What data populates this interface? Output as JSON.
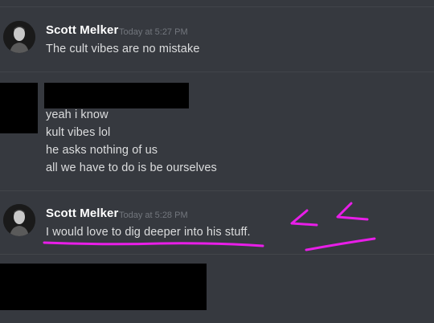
{
  "messages": [
    {
      "author": "Scott Melker",
      "timestamp": "Today at 5:27 PM",
      "lines": [
        "The cult vibes are no mistake"
      ]
    },
    {
      "author": "",
      "timestamp": "",
      "lines": [
        "yeah i know",
        "kult vibes lol",
        "he asks nothing of us",
        "all we have to do is be ourselves"
      ]
    },
    {
      "author": "Scott Melker",
      "timestamp": "Today at 5:28 PM",
      "lines": [
        "I would love to dig deeper into his stuff."
      ]
    }
  ],
  "colors": {
    "background": "#36393f",
    "username": "#ffffff",
    "message_text": "#dcddde",
    "timestamp": "#72767d",
    "annotation": "#e81ee8",
    "redaction": "#000000"
  },
  "icons": [
    "avatar-portrait"
  ]
}
